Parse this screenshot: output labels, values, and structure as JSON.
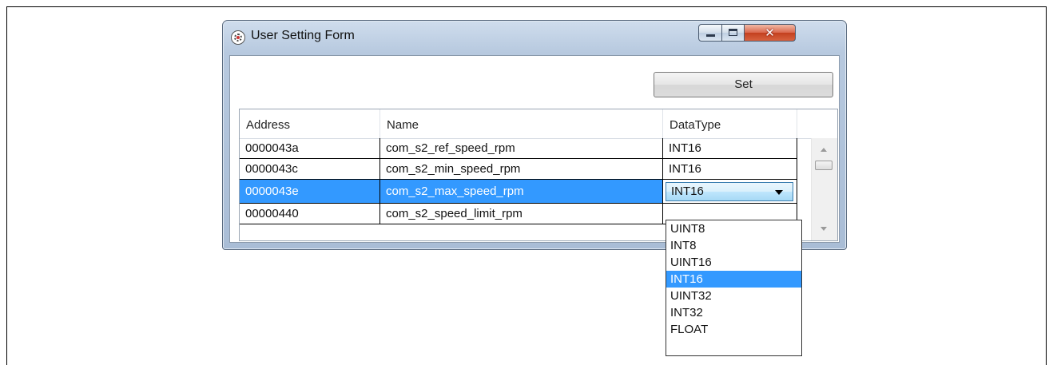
{
  "window": {
    "title": "User Setting Form",
    "icon": "app-icon",
    "controls": {
      "minimize": "minimize-icon",
      "maximize": "maximize-icon",
      "close": "close-icon"
    }
  },
  "toolbar": {
    "set_label": "Set"
  },
  "grid": {
    "columns": [
      "Address",
      "Name",
      "DataType"
    ],
    "rows": [
      {
        "address": "0000043a",
        "name": "com_s2_ref_speed_rpm",
        "datatype": "INT16"
      },
      {
        "address": "0000043c",
        "name": "com_s2_min_speed_rpm",
        "datatype": "INT16"
      },
      {
        "address": "0000043e",
        "name": "com_s2_max_speed_rpm",
        "datatype": "INT16"
      },
      {
        "address": "00000440",
        "name": "com_s2_speed_limit_rpm",
        "datatype": ""
      }
    ],
    "selected_row": 2
  },
  "dropdown": {
    "options": [
      "UINT8",
      "INT8",
      "UINT16",
      "INT16",
      "UINT32",
      "INT32",
      "FLOAT"
    ],
    "highlighted": "INT16"
  },
  "colors": {
    "selection": "#3399ff",
    "close_button": "#c3401f"
  }
}
